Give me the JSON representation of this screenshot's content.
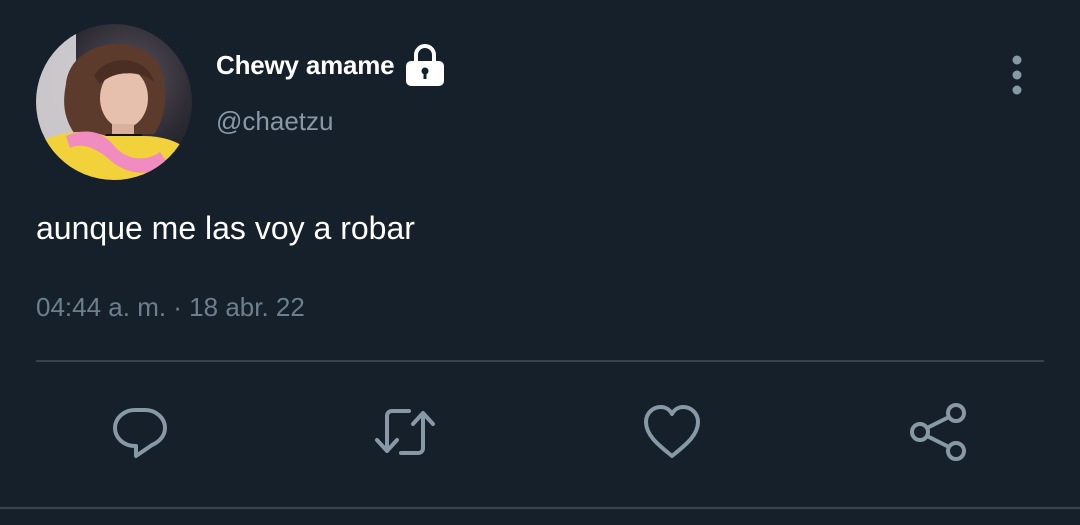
{
  "tweet": {
    "display_name": "Chewy amame",
    "handle": "@chaetzu",
    "text": "aunque me las voy a robar",
    "timestamp": "04:44 a. m. · 18 abr. 22",
    "protected_icon": "lock-icon",
    "more_icon": "more-vertical-icon"
  },
  "actions": {
    "reply_icon": "reply-icon",
    "retweet_icon": "retweet-icon",
    "like_icon": "heart-icon",
    "share_icon": "share-icon"
  },
  "colors": {
    "background": "#15202b",
    "primary_text": "#ffffff",
    "secondary_text": "#8899a6",
    "icon": "#8899a6",
    "divider": "#38444d"
  }
}
